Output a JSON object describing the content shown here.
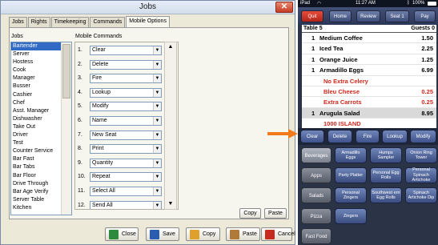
{
  "dialog": {
    "title": "Jobs",
    "close_glyph": "✕",
    "tabs": [
      "Jobs",
      "Rights",
      "Timekeeping",
      "Commands",
      "Mobile Options"
    ],
    "active_tab": "Mobile Options",
    "jobs_label": "Jobs",
    "mobile_commands_label": "Mobile Commands",
    "jobs": [
      "Bartender",
      "Server",
      "Hostess",
      "Cook",
      "Manager",
      "Busser",
      "Cashier",
      "Chef",
      "Asst. Manager",
      "Dishwasher",
      "Take Out",
      "Driver",
      "Test",
      "Counter Service",
      "Bar Fast",
      "Bar Tabs",
      "Bar Floor",
      "Drive Through",
      "Bar Age Verify",
      "Server Table",
      "Kitchen"
    ],
    "selected_job": "Bartender",
    "commands": [
      {
        "num": "1.",
        "value": "Clear"
      },
      {
        "num": "2.",
        "value": "Delete"
      },
      {
        "num": "3.",
        "value": "Fire"
      },
      {
        "num": "4.",
        "value": "Lookup"
      },
      {
        "num": "5.",
        "value": "Modify"
      },
      {
        "num": "6.",
        "value": "Name"
      },
      {
        "num": "7.",
        "value": "New Seat"
      },
      {
        "num": "8.",
        "value": "Print"
      },
      {
        "num": "9.",
        "value": "Quantity"
      },
      {
        "num": "10.",
        "value": "Repeat"
      },
      {
        "num": "11.",
        "value": "Select All"
      },
      {
        "num": "12.",
        "value": "Send All"
      }
    ],
    "copy_label": "Copy",
    "paste_label": "Paste",
    "buttons": {
      "close": "Close",
      "save": "Save",
      "copy": "Copy",
      "paste": "Paste",
      "cancel": "Cancel"
    },
    "button_icons": {
      "close": "exit-icon",
      "save": "floppy-icon",
      "copy": "copy-icon",
      "paste": "paste-icon",
      "cancel": "x-icon"
    }
  },
  "arrow_color": "#f07a1c",
  "pos": {
    "status": {
      "carrier": "iPad",
      "wifi": "wifi-icon",
      "time": "11:27 AM",
      "bluetooth": "bluetooth-icon",
      "battery": "100%"
    },
    "topbar": [
      "Quit",
      "Home",
      "Review",
      "Seat 1",
      "Pay"
    ],
    "ticket_header": {
      "left": "Table 5",
      "right": "Guests 0"
    },
    "ticket_items": [
      {
        "qty": "1",
        "name": "Medium Coffee",
        "price": "1.50",
        "type": "item"
      },
      {
        "qty": "1",
        "name": "Iced Tea",
        "price": "2.25",
        "type": "item"
      },
      {
        "qty": "1",
        "name": "Orange Juice",
        "price": "1.25",
        "type": "item"
      },
      {
        "qty": "1",
        "name": "Armadillo Eggs",
        "price": "6.99",
        "type": "item"
      },
      {
        "qty": "",
        "name": "No Extra Celery",
        "price": "",
        "type": "mod"
      },
      {
        "qty": "",
        "name": "Bleu Cheese",
        "price": "0.25",
        "type": "mod"
      },
      {
        "qty": "",
        "name": "Extra Carrots",
        "price": "0.25",
        "type": "mod"
      },
      {
        "qty": "1",
        "name": "Arugula Salad",
        "price": "8.95",
        "type": "selected"
      },
      {
        "qty": "",
        "name": "1000 ISLAND",
        "price": "",
        "type": "cut"
      }
    ],
    "mod_buttons": [
      "Clear",
      "Delete",
      "Fire",
      "Lookup",
      "Modify"
    ],
    "categories": [
      "Beverages",
      "Apps",
      "Salads",
      "Pizza",
      "Fast Food"
    ],
    "selected_category": "Beverages",
    "menu_items": [
      [
        "Armadillo Eggs",
        "Humps Sampler",
        "Onion Ring Tower"
      ],
      [
        "Party Platter",
        "Personal Egg Rolls",
        "Personal Spinach Artichoke"
      ],
      [
        "Personal Zingers",
        "Southwest ern Egg Rolls",
        "Spinach Artichoke Dip"
      ],
      [
        "Zingers",
        "",
        ""
      ]
    ],
    "colors": {
      "quit": "#d0281e",
      "modifier_text": "#d0281e",
      "accent": "#f07a1c"
    }
  }
}
